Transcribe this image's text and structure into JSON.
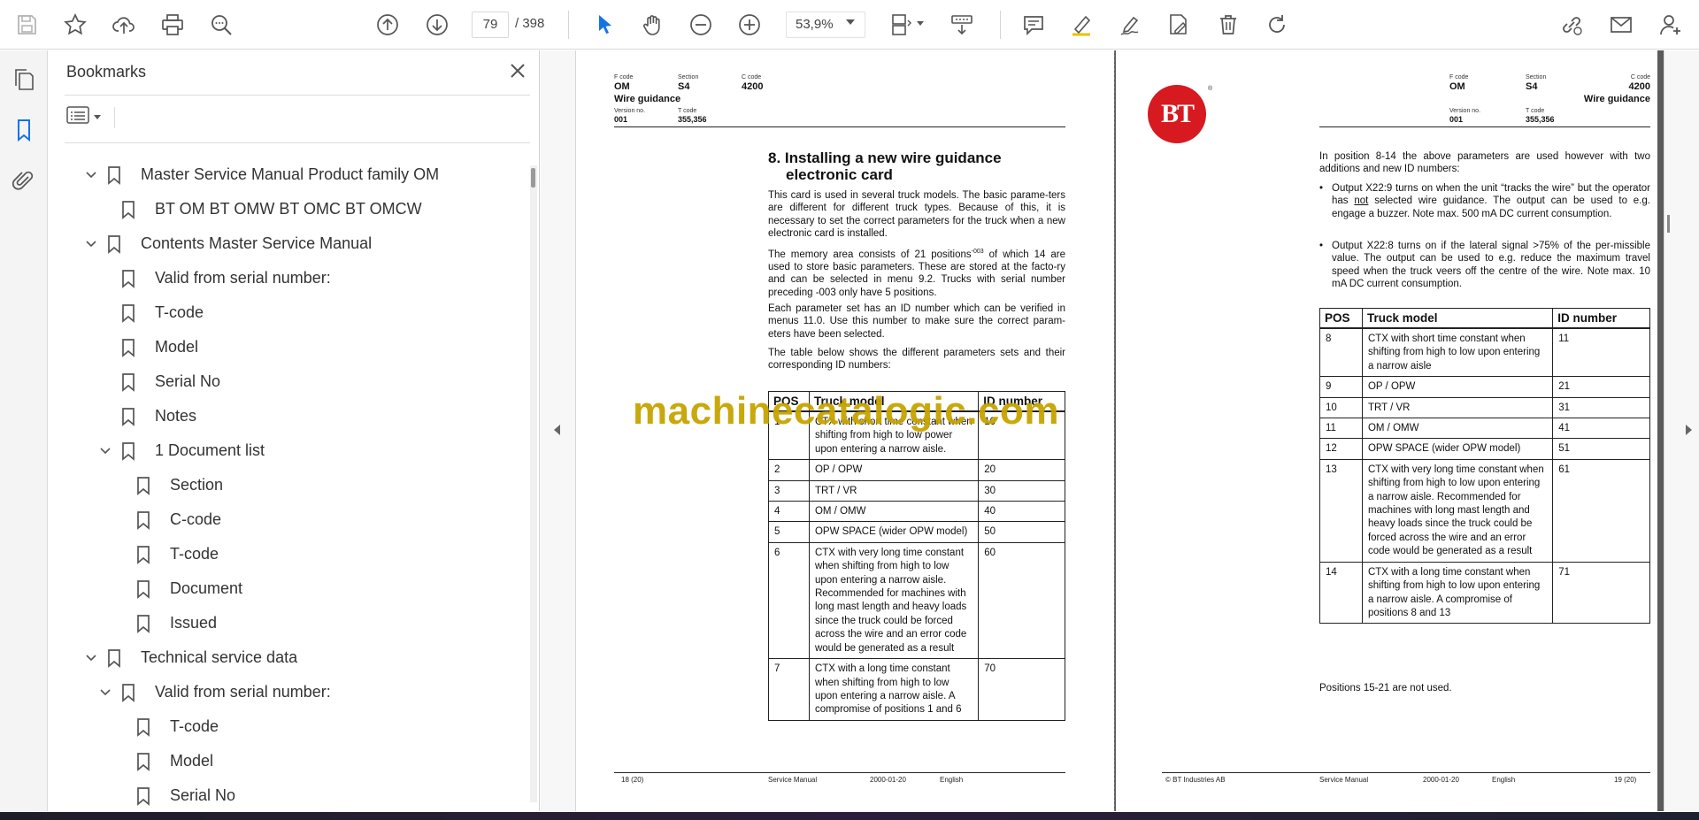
{
  "toolbar": {
    "page_current": "79",
    "page_total": "/ 398",
    "zoom": "53,9%"
  },
  "bookmarks": {
    "title": "Bookmarks",
    "items": [
      {
        "label": "Master Service Manual Product family OM",
        "level": 0,
        "expanded": true
      },
      {
        "label": "BT OM BT OMW BT OMC BT OMCW",
        "level": 1,
        "expanded": null
      },
      {
        "label": "Contents Master Service Manual",
        "level": 0,
        "expanded": true
      },
      {
        "label": "Valid from serial number:",
        "level": 1,
        "expanded": null
      },
      {
        "label": "T-code",
        "level": 1,
        "expanded": null
      },
      {
        "label": "Model",
        "level": 1,
        "expanded": null
      },
      {
        "label": "Serial No",
        "level": 1,
        "expanded": null
      },
      {
        "label": "Notes",
        "level": 1,
        "expanded": null
      },
      {
        "label": "1 Document list",
        "level": 1,
        "expanded": true
      },
      {
        "label": "Section",
        "level": 2,
        "expanded": null
      },
      {
        "label": "C-code",
        "level": 2,
        "expanded": null
      },
      {
        "label": "T-code",
        "level": 2,
        "expanded": null
      },
      {
        "label": "Document",
        "level": 2,
        "expanded": null
      },
      {
        "label": "Issued",
        "level": 2,
        "expanded": null
      },
      {
        "label": "Technical service data",
        "level": 0,
        "expanded": true
      },
      {
        "label": "Valid from serial number:",
        "level": 1,
        "expanded": true
      },
      {
        "label": "T-code",
        "level": 2,
        "expanded": null
      },
      {
        "label": "Model",
        "level": 2,
        "expanded": null
      },
      {
        "label": "Serial No",
        "level": 2,
        "expanded": null
      }
    ]
  },
  "left_page": {
    "header": {
      "fcode_label": "F code",
      "fcode": "OM",
      "section_label": "Section",
      "section": "S4",
      "ccode_label": "C code",
      "ccode": "4200",
      "title": "Wire guidance",
      "version_label": "Version no.",
      "version": "001",
      "tcode_label": "T code",
      "tcode": "355,356"
    },
    "heading_line1": "8. Installing a new wire guidance",
    "heading_line2": "electronic card",
    "p1": "This card is used in several truck models. The basic parame-ters are different for different truck types. Because of this, it is necessary to set the correct parameters for the truck when a new electronic card is installed.",
    "p2a": "The memory area consists of 21 positions",
    "p2sup": "-003",
    "p2b": " of which 14 are used to store basic parameters. These are stored at the facto-ry and can be selected in menu 9.2. Trucks with serial number preceding -003 only have 5 positions.",
    "p3": "Each parameter set has an ID number which can be verified in menus 11.0. Use this number to make sure the correct param-eters have been selected.",
    "p4": "The table below shows the different parameters sets and their corresponding ID numbers:",
    "table": {
      "headers": [
        "POS",
        "Truck model",
        "ID number"
      ],
      "rows": [
        [
          "1",
          "CTX with short time constant when shifting from high to low power upon entering a narrow aisle.",
          "10"
        ],
        [
          "2",
          "OP / OPW",
          "20"
        ],
        [
          "3",
          "TRT / VR",
          "30"
        ],
        [
          "4",
          "OM / OMW",
          "40"
        ],
        [
          "5",
          "OPW SPACE (wider OPW model)",
          "50"
        ],
        [
          "6",
          "CTX with very long time constant when shifting from high to low upon entering a narrow aisle. Recommended for machines with long mast length and heavy loads since the truck could be forced across the wire and an error code would be generated as a result",
          "60"
        ],
        [
          "7",
          "CTX with a long time constant when shifting from high to low upon entering a narrow aisle. A compromise of positions 1 and 6",
          "70"
        ]
      ]
    },
    "footer": {
      "page": "18 (20)",
      "manual": "Service Manual",
      "date": "2000-01-20",
      "lang": "English"
    }
  },
  "watermark": "machinecatalogic.com",
  "right_page": {
    "logo_text": "BT",
    "logo_reg": "®",
    "header": {
      "fcode_label": "F code",
      "fcode": "OM",
      "section_label": "Section",
      "section": "S4",
      "ccode_label": "C code",
      "ccode": "4200",
      "title": "Wire guidance",
      "version_label": "Version no.",
      "version": "001",
      "tcode_label": "T code",
      "tcode": "355,356"
    },
    "intro": "In position 8-14 the above parameters are used however with two additions and new ID numbers:",
    "bullet1a": "Output X22:9 turns on when the unit “tracks the wire” but the operator has ",
    "bullet1u": "not",
    "bullet1b": " selected wire guidance. The output can be used to e.g. engage a buzzer. Note max. 500 mA DC current consumption.",
    "bullet2": "Output X22:8 turns on if the lateral signal >75% of the per-missible value. The output can be used to e.g. reduce the maximum travel speed when the truck veers off the centre of the wire. Note max. 10 mA DC current consumption.",
    "table": {
      "headers": [
        "POS",
        "Truck model",
        "ID number"
      ],
      "rows": [
        [
          "8",
          "CTX with short time constant when shifting from high to low upon entering a narrow aisle",
          "11"
        ],
        [
          "9",
          "OP / OPW",
          "21"
        ],
        [
          "10",
          "TRT / VR",
          "31"
        ],
        [
          "11",
          "OM / OMW",
          "41"
        ],
        [
          "12",
          "OPW SPACE (wider OPW model)",
          "51"
        ],
        [
          "13",
          "CTX with very long time constant when shifting from high to low upon entering a narrow aisle. Recommended for machines with long mast length and heavy loads since the truck could be forced across the wire and an error code would be generated as a result",
          "61"
        ],
        [
          "14",
          "CTX with a long time constant when shifting from high to low upon entering a narrow aisle. A compromise of positions 8 and 13",
          "71"
        ]
      ]
    },
    "after_table": "Positions 15-21 are not used.",
    "footer": {
      "company": "© BT Industries AB",
      "manual": "Service Manual",
      "date": "2000-01-20",
      "lang": "English",
      "page": "19 (20)"
    }
  }
}
